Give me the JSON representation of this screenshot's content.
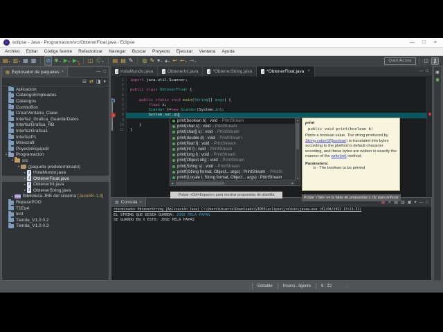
{
  "colors": {
    "keyword": "#c75fa0",
    "type_name": "#39b3a8",
    "method_green": "#98c763",
    "current_line": "#0d5860",
    "error_red": "#c23b32",
    "console_input": "#3f9dc6",
    "javadoc_bg": "#f8f6df"
  },
  "window": {
    "title": "eclipse - Java - Programacion/src/ObtenerFloat.java - Eclipse",
    "controls": [
      {
        "name": "minimize",
        "glyph": "—"
      },
      {
        "name": "maximize",
        "glyph": "□"
      },
      {
        "name": "close",
        "glyph": "×"
      }
    ],
    "menus": [
      "Archivo",
      "Editar",
      "Código fuente",
      "Refactorizar",
      "Navegar",
      "Buscar",
      "Proyecto",
      "Ejecutar",
      "Ventana",
      "Ayuda"
    ]
  },
  "toolbar": {
    "quick_access": "Quick Access",
    "icons": [
      {
        "name": "new-wizard",
        "glyph": "▤",
        "color": "#d9a74a",
        "dropdown": true
      },
      {
        "name": "new-menu",
        "glyph": "▥",
        "color": "#b9a05a",
        "dropdown": true
      },
      {
        "name": "save",
        "glyph": "▦",
        "color": "#9fb6c9"
      },
      {
        "name": "save-all",
        "glyph": "▩",
        "color": "#9fb6c9"
      },
      {
        "sep": true
      },
      {
        "name": "skip-all-breakpoints",
        "glyph": "⊘",
        "color": "#6fb3e0",
        "boxed": true
      },
      {
        "name": "debug",
        "glyph": "✱",
        "color": "#7ea85a",
        "dropdown": true
      },
      {
        "name": "run",
        "glyph": "▶",
        "color": "#4caf50",
        "dropdown": true
      },
      {
        "name": "run-last-problem",
        "glyph": "▶",
        "color": "#4caf50",
        "badge": "#c0392b",
        "dropdown": true
      },
      {
        "sep": true
      },
      {
        "name": "new-java-project",
        "glyph": "◫",
        "color": "#c9a05a"
      },
      {
        "name": "new-class",
        "glyph": "Ⓒ",
        "color": "#69b05e",
        "dropdown": true
      },
      {
        "sep": true
      },
      {
        "name": "open-type",
        "glyph": "▤",
        "color": "#d9a74a"
      },
      {
        "name": "open-resource",
        "glyph": "▤",
        "color": "#d9a74a"
      },
      {
        "name": "external-tools",
        "glyph": "✎",
        "color": "#d8d8d8"
      },
      {
        "sep": true
      },
      {
        "name": "search",
        "glyph": "◎",
        "color": "#d8cf6a"
      },
      {
        "name": "mark-occurrences",
        "glyph": "✎",
        "color": "#e0d060"
      },
      {
        "name": "next-annotation",
        "glyph": "▾",
        "color": "#b9bdbf",
        "dropdown": true
      },
      {
        "name": "prev-annotation",
        "glyph": "▴",
        "color": "#b9bdbf",
        "dropdown": true
      },
      {
        "name": "last-edit-location",
        "glyph": "↩",
        "color": "#d9a74a"
      },
      {
        "name": "back",
        "glyph": "←",
        "color": "#d9a74a",
        "dropdown": true
      },
      {
        "name": "forward",
        "glyph": "→",
        "color": "#85898b",
        "dropdown": true
      }
    ],
    "perspectives": [
      {
        "name": "open-perspective",
        "glyph": "◫",
        "active": false
      },
      {
        "name": "java-perspective",
        "glyph": "J",
        "active": true
      }
    ]
  },
  "explorer": {
    "title": "Explorador de paquetes",
    "toolbar_icons": [
      {
        "name": "collapse-all",
        "glyph": "⊟",
        "color": "#b8bcbe"
      },
      {
        "name": "link-with-editor",
        "glyph": "⇄",
        "color": "#d8c24a"
      },
      {
        "name": "focus-active-task",
        "glyph": "◨",
        "color": "#b8bcbe"
      },
      {
        "name": "view-menu",
        "glyph": "▾",
        "color": "#b8bcbe"
      }
    ],
    "items": [
      {
        "label": "Aplicacion",
        "level": 0,
        "icon": "folder"
      },
      {
        "label": "CatalogoEmpleados",
        "level": 0,
        "icon": "folder"
      },
      {
        "label": "Catalogos",
        "level": 0,
        "icon": "folder"
      },
      {
        "label": "ComboBox",
        "level": 0,
        "icon": "folder"
      },
      {
        "label": "CrearVentana_Clase",
        "level": 0,
        "icon": "folder"
      },
      {
        "label": "Interfaz_Grafica_GuardarDatos",
        "level": 0,
        "icon": "folder"
      },
      {
        "label": "InterfazGrafica_RB",
        "level": 0,
        "icon": "folder"
      },
      {
        "label": "InterfazGrafica1",
        "level": 0,
        "icon": "folder"
      },
      {
        "label": "InterfazP1",
        "level": 0,
        "icon": "folder"
      },
      {
        "label": "Minecraft",
        "level": 0,
        "icon": "folder"
      },
      {
        "label": "PoyectoEquipo8",
        "level": 0,
        "icon": "folder"
      },
      {
        "label": "Programacion",
        "level": 0,
        "icon": "project",
        "arrow": "open"
      },
      {
        "label": "src",
        "level": 1,
        "icon": "src",
        "arrow": "open"
      },
      {
        "label": "(paquete predeterminado)",
        "level": 2,
        "icon": "package",
        "arrow": "open"
      },
      {
        "label": "HolaMundo.java",
        "level": 3,
        "icon": "jfile",
        "arrow": "closed"
      },
      {
        "label": "ObtenerFloat.java",
        "level": 3,
        "icon": "jfile",
        "arrow": "closed",
        "selected": true
      },
      {
        "label": "ObtenerInt.java",
        "level": 3,
        "icon": "jfile",
        "arrow": "closed"
      },
      {
        "label": "ObtenerString.java",
        "level": 3,
        "icon": "jfile",
        "arrow": "closed"
      },
      {
        "label": "Biblioteca JRE del sistema",
        "suffix": "[JavaSE-1.8]",
        "level": 1,
        "icon": "library",
        "arrow": "closed"
      },
      {
        "label": "RepasoPOO",
        "level": 0,
        "icon": "folder"
      },
      {
        "label": "T1Eq4",
        "level": 0,
        "icon": "folder"
      },
      {
        "label": "test",
        "level": 0,
        "icon": "folder"
      },
      {
        "label": "Tienda_V1.0.0.2",
        "level": 0,
        "icon": "folder"
      },
      {
        "label": "Tienda_V1.0.0.3",
        "level": 0,
        "icon": "folder"
      }
    ]
  },
  "editor": {
    "tabs": [
      {
        "label": "HolaMundo.java",
        "active": false
      },
      {
        "label": "ObtenerInt.java",
        "active": false
      },
      {
        "label": "*ObtenerString.java",
        "active": false
      },
      {
        "label": "*ObtenerFloat.java",
        "active": true
      }
    ],
    "current_line": 8,
    "lines": [
      {
        "num": 1,
        "segs": [
          {
            "c": "kw",
            "t": "import "
          },
          {
            "c": "pl",
            "t": "java.util.Scanner;"
          }
        ]
      },
      {
        "num": 2,
        "segs": []
      },
      {
        "num": 3,
        "segs": [
          {
            "c": "kw",
            "t": "public class "
          },
          {
            "c": "ty",
            "t": "ObtenerFloat"
          },
          {
            "c": "pl",
            "t": " {"
          }
        ]
      },
      {
        "num": 4,
        "segs": []
      },
      {
        "num": 5,
        "segs": [
          {
            "c": "pl",
            "t": "    "
          },
          {
            "c": "kw",
            "t": "public static void "
          },
          {
            "c": "fn",
            "t": "main"
          },
          {
            "c": "pl",
            "t": "("
          },
          {
            "c": "ty",
            "t": "String"
          },
          {
            "c": "pl",
            "t": "[] "
          },
          {
            "c": "ty",
            "t": "args"
          },
          {
            "c": "pl",
            "t": ") {"
          }
        ]
      },
      {
        "num": 6,
        "segs": [
          {
            "c": "pl",
            "t": "        "
          },
          {
            "c": "kw",
            "t": "float "
          },
          {
            "c": "pl",
            "t": "x;"
          }
        ]
      },
      {
        "num": 7,
        "segs": [
          {
            "c": "pl",
            "t": "        "
          },
          {
            "c": "ty",
            "t": "Scanner"
          },
          {
            "c": "pl",
            "t": " t="
          },
          {
            "c": "kw",
            "t": "new "
          },
          {
            "c": "ty",
            "t": "Scanner"
          },
          {
            "c": "pl",
            "t": "(System."
          },
          {
            "c": "fl",
            "t": "in"
          },
          {
            "c": "pl",
            "t": ");"
          }
        ]
      },
      {
        "num": 8,
        "segs": [
          {
            "c": "pl",
            "t": "        System.out.pi"
          }
        ]
      },
      {
        "num": 9,
        "segs": []
      },
      {
        "num": 10,
        "segs": [
          {
            "c": "pl",
            "t": "    }"
          }
        ]
      },
      {
        "num": 11,
        "segs": [
          {
            "c": "pl",
            "t": "}"
          }
        ]
      }
    ]
  },
  "assist": {
    "items": [
      {
        "label": "print(boolean b) : void",
        "from": "- PrintStream",
        "selected": true
      },
      {
        "label": "print(char c) : void",
        "from": "- PrintStream"
      },
      {
        "label": "print(char[] s) : void",
        "from": "- PrintStream"
      },
      {
        "label": "print(double d) : void",
        "from": "- PrintStream"
      },
      {
        "label": "print(float f) : void",
        "from": "- PrintStream"
      },
      {
        "label": "print(int i) : void",
        "from": "- PrintStream"
      },
      {
        "label": "print(long l) : void",
        "from": "- PrintStream"
      },
      {
        "label": "print(Object obj) : void",
        "from": "- PrintStream"
      },
      {
        "label": "print(String s) : void",
        "from": "- PrintStream"
      },
      {
        "label": "printf(String format, Object... args) : PrintStream",
        "from": "- PrintSt"
      },
      {
        "label": "printf(Locale l, String format, Object... args) : PrintStream",
        "from": ""
      }
    ],
    "hint": "Pulsar «Ctrl+Espacio» para mostrar propuestas de plantilla"
  },
  "javadoc": {
    "title": "print",
    "signature": "public void print(boolean b)",
    "body": [
      {
        "t": "Prints a boolean value. The string produced by ",
        "link": false
      },
      {
        "t": "String.valueOf(boolean)",
        "link": true
      },
      {
        "t": " is translated into bytes according to the platform's default character encoding, and these bytes are written in exactly the manner of the ",
        "link": false
      },
      {
        "t": "write(int)",
        "link": true
      },
      {
        "t": " method.",
        "link": false
      }
    ],
    "parameters_label": "Parameters:",
    "parameter": "b - The boolean to be printed",
    "hint": "Pulsar «Tab» en la tabla de propuestas o clic para enfocar"
  },
  "console": {
    "tab": "Consola",
    "toolbar_icons": [
      {
        "name": "terminate",
        "glyph": "■",
        "color": "#a05050"
      },
      {
        "name": "remove-launch",
        "glyph": "×",
        "color": "#aab0b2"
      },
      {
        "name": "clear-console",
        "glyph": "▤",
        "color": "#aab0b2"
      },
      {
        "name": "scroll-lock",
        "glyph": "▥",
        "color": "#aab0b2"
      },
      {
        "name": "pin-console",
        "glyph": "▣",
        "color": "#aab0b2"
      },
      {
        "name": "display-selected-console",
        "glyph": "▾",
        "color": "#aab0b2"
      }
    ],
    "header": "<terminado> ObtenerString [Aplicación Java] C:\\Users\\Usuario\\Downloads\\VIDEO\\eclipse\\jre\\bin\\javaw.exe (02/04/2022 13:21:32)",
    "lines": [
      {
        "text": "EL STRING QUE DESEA GUARDA: ",
        "input": "JOSE PELA PAPAS"
      },
      {
        "text": "SE GUARDO EN X ESTO: JOSE PELA PAPAS",
        "input": ""
      }
    ]
  },
  "right_strip": {
    "icons": [
      {
        "name": "minimized-view-1",
        "glyph": "▣",
        "color": "#c0c3c5"
      },
      {
        "name": "minimized-view-2",
        "glyph": "●",
        "color": "#6cae5e"
      }
    ]
  },
  "status": {
    "editable": "Editable",
    "mode": "Inserci...ligente",
    "caret": "8 : 22",
    "overflow": "⋮"
  }
}
